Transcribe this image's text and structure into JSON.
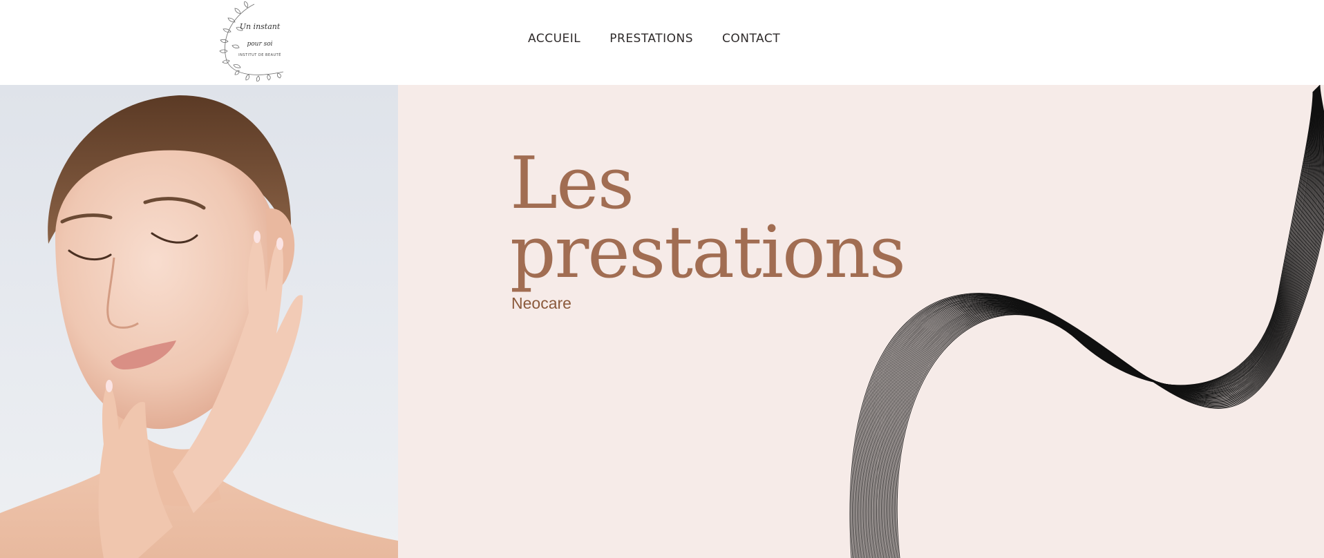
{
  "header": {
    "logo": {
      "icon": "laurel-wreath-logo",
      "line1": "Un instant",
      "line2": "pour soi",
      "line3": "INSTITUT DE BEAUTÉ"
    },
    "nav": [
      {
        "label": "ACCUEIL"
      },
      {
        "label": "PRESTATIONS"
      },
      {
        "label": "CONTACT"
      }
    ]
  },
  "hero": {
    "title_line1": "Les",
    "title_line2": "prestations",
    "subtitle": "Neocare",
    "image": "woman-skincare-portrait",
    "decoration": "line-wave-pattern"
  },
  "colors": {
    "accent": "#a16d52",
    "subtitle": "#8b5a3c",
    "hero_bg": "#f6ebe8",
    "nav_text": "#2e2a2a"
  }
}
